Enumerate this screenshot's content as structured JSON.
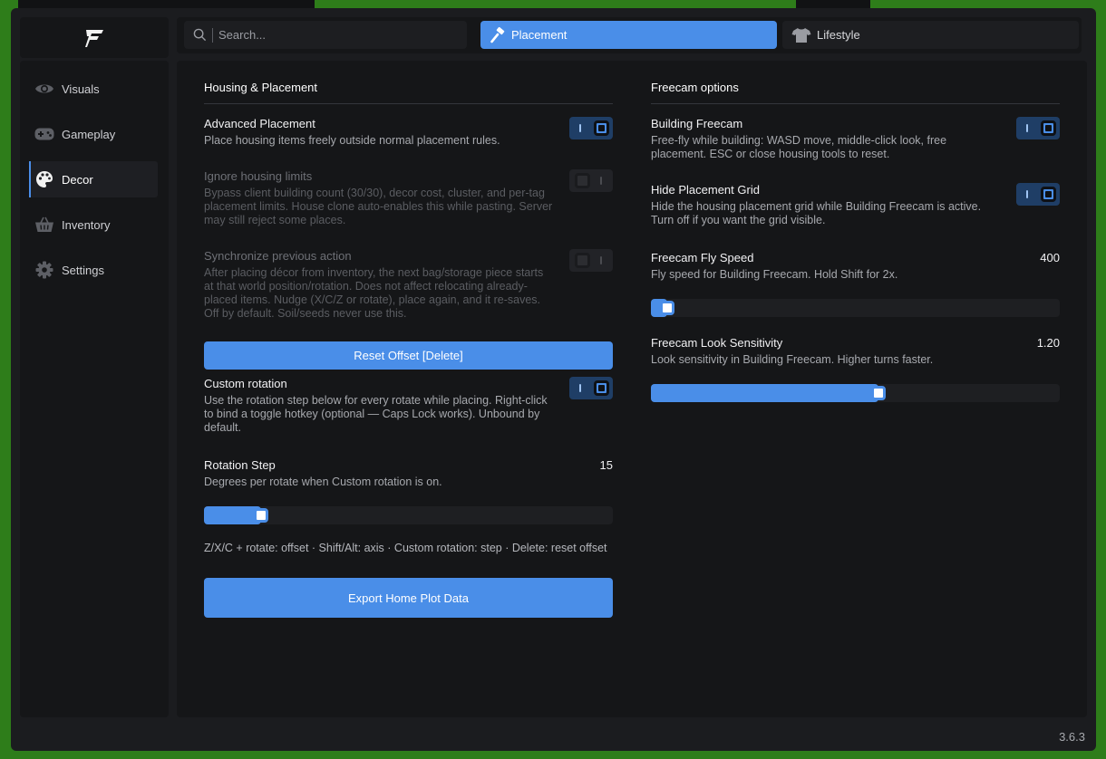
{
  "search": {
    "placeholder": "Search..."
  },
  "tabs": [
    {
      "label": "Placement",
      "icon": "hammer-icon",
      "active": true
    },
    {
      "label": "Lifestyle",
      "icon": "shirt-icon",
      "active": false
    }
  ],
  "sidebar": {
    "items": [
      {
        "label": "Visuals",
        "icon": "eye-icon"
      },
      {
        "label": "Gameplay",
        "icon": "gamepad-icon"
      },
      {
        "label": "Decor",
        "icon": "palette-icon",
        "active": true
      },
      {
        "label": "Inventory",
        "icon": "basket-icon"
      },
      {
        "label": "Settings",
        "icon": "gear-icon"
      }
    ]
  },
  "left": {
    "title": "Housing & Placement",
    "advanced_placement": {
      "name": "Advanced Placement",
      "desc": "Place housing items freely outside normal placement rules.",
      "on": true
    },
    "ignore_limits": {
      "name": "Ignore housing limits",
      "desc": "Bypass client building count (30/30), decor cost, cluster, and per-tag placement limits. House clone auto-enables this while pasting. Server may still reject some places.",
      "on": false
    },
    "sync_previous": {
      "name": "Synchronize previous action",
      "desc": "After placing décor from inventory, the next bag/storage piece starts at that world position/rotation. Does not affect relocating already-placed items. Nudge (X/C/Z or rotate), place again, and it re-saves. Off by default. Soil/seeds never use this.",
      "on": false
    },
    "reset_button": "Reset Offset [Delete]",
    "custom_rotation": {
      "name": "Custom rotation",
      "desc": "Use the rotation step below for every rotate while placing. Right-click to bind a toggle hotkey (optional — Caps Lock works). Unbound by default.",
      "on": true
    },
    "rotation_step": {
      "name": "Rotation Step",
      "desc": "Degrees per rotate when Custom rotation is on.",
      "value": "15",
      "fraction": 0.14
    },
    "hint": "Z/X/C + rotate: offset · Shift/Alt: axis · Custom rotation: step · Delete: reset offset",
    "export_button": "Export Home Plot Data"
  },
  "right": {
    "title": "Freecam options",
    "building_freecam": {
      "name": "Building Freecam",
      "desc": "Free-fly while building: WASD move, middle-click look, free placement. ESC or close housing tools to reset.",
      "on": true
    },
    "hide_grid": {
      "name": "Hide Placement Grid",
      "desc": "Hide the housing placement grid while Building Freecam is active. Turn off if you want the grid visible.",
      "on": true
    },
    "fly_speed": {
      "name": "Freecam Fly Speed",
      "desc": "Fly speed for Building Freecam. Hold Shift for 2x.",
      "value": "400",
      "fraction": 0.04
    },
    "look_sensitivity": {
      "name": "Freecam Look Sensitivity",
      "desc": "Look sensitivity in Building Freecam. Higher turns faster.",
      "value": "1.20",
      "fraction": 0.557
    }
  },
  "version": "3.6.3",
  "colors": {
    "accent": "#4a8ee8",
    "background": "#1b1c1f",
    "panel": "#151618"
  }
}
